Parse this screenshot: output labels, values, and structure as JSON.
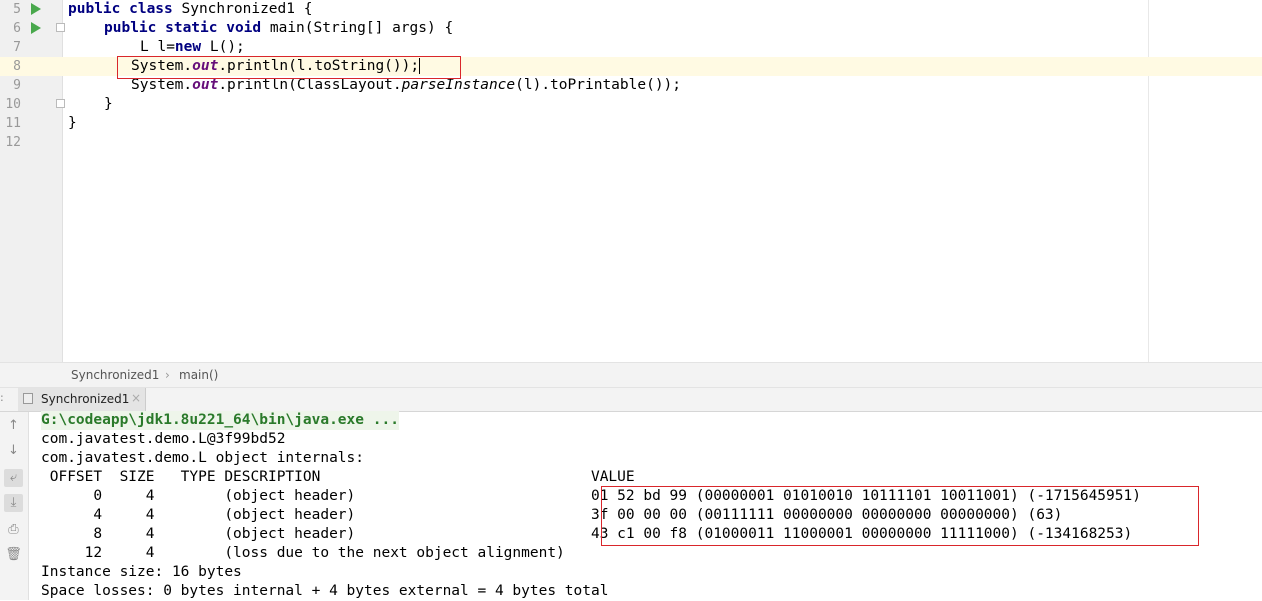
{
  "editor": {
    "lines": [
      {
        "num": "5"
      },
      {
        "num": "6"
      },
      {
        "num": "7"
      },
      {
        "num": "8"
      },
      {
        "num": "9"
      },
      {
        "num": "10"
      },
      {
        "num": "11"
      },
      {
        "num": "12"
      }
    ],
    "code": {
      "l5_kw": "public class",
      "l5_rest": " Synchronized1 {",
      "l6_kw": "public static void",
      "l6_rest": " main(String[] args) {",
      "l7_pre": "L l=",
      "l7_kw": "new",
      "l7_post": " L();",
      "l8_pre": "System.",
      "l8_fld": "out",
      "l8_post": ".println(l.toString());",
      "l9_pre": "System.",
      "l9_fld": "out",
      "l9_mid": ".println(ClassLayout.",
      "l9_it": "parseInstance",
      "l9_post": "(l).toPrintable());",
      "l10": "}",
      "l11": "}"
    }
  },
  "breadcrumb": {
    "class": "Synchronized1",
    "sep": "›",
    "method": "main()"
  },
  "run_tab": {
    "label": "Synchronized1",
    "close": "×",
    "dots": ":"
  },
  "console": {
    "command": "G:\\codeapp\\jdk1.8u221_64\\bin\\java.exe ...",
    "lines": [
      "com.javatest.demo.L@3f99bd52",
      "com.javatest.demo.L object internals:",
      " OFFSET  SIZE   TYPE DESCRIPTION                               VALUE",
      "      0     4        (object header)                           01 52 bd 99 (00000001 01010010 10111101 10011001) (-1715645951)",
      "      4     4        (object header)                           3f 00 00 00 (00111111 00000000 00000000 00000000) (63)",
      "      8     4        (object header)                           43 c1 00 f8 (01000011 11000001 00000000 11111000) (-134168253)",
      "     12     4        (loss due to the next object alignment)",
      "Instance size: 16 bytes",
      "Space losses: 0 bytes internal + 4 bytes external = 4 bytes total"
    ]
  },
  "tools": {
    "up": "↑",
    "down": "↓",
    "wrap": "⤶",
    "scroll_end": "⤓",
    "print": "⎙",
    "trash": "🗑"
  },
  "colors": {
    "highlight_box": "#d9262b",
    "run_icon": "#49a84c",
    "keyword": "#000080",
    "field": "#660e7a"
  }
}
